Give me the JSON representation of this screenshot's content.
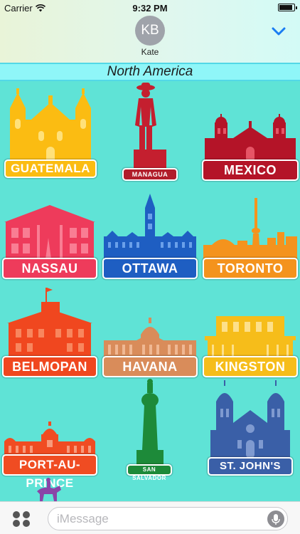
{
  "status_bar": {
    "carrier": "Carrier",
    "time": "9:32 PM"
  },
  "header": {
    "avatar_initials": "KB",
    "contact_name": "Kate"
  },
  "category": {
    "title": "North America"
  },
  "stickers": [
    {
      "label": "GUATEMALA",
      "color": "#fbbc12"
    },
    {
      "label": "MANAGUA",
      "color": "#b11d2a"
    },
    {
      "label": "MEXICO",
      "color": "#b41428"
    },
    {
      "label": "NASSAU",
      "color": "#ee3b5b"
    },
    {
      "label": "OTTAWA",
      "color": "#1e5ec2"
    },
    {
      "label": "TORONTO",
      "color": "#f4931d"
    },
    {
      "label": "BELMOPAN",
      "color": "#f0471f"
    },
    {
      "label": "HAVANA",
      "color": "#d98c5a"
    },
    {
      "label": "KINGSTON",
      "color": "#f6bd1a"
    },
    {
      "label": "PORT-AU-PRINCE",
      "color": "#f04c22"
    },
    {
      "label": "SAN SALVADOR",
      "color": "#1d8a39"
    },
    {
      "label": "ST. JOHN'S",
      "color": "#3a5fa7"
    }
  ],
  "compose": {
    "placeholder": "iMessage"
  },
  "icons": [
    "wifi-icon",
    "battery-icon",
    "chevron-down-icon",
    "apps-icon",
    "microphone-icon"
  ]
}
